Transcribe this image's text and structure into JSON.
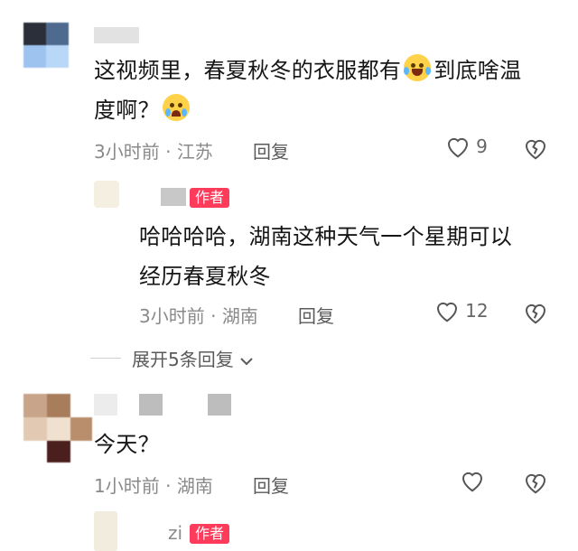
{
  "comments": [
    {
      "text_line1": "这视频里，春夏秋冬的衣服都有",
      "text_line1b": "到底啥温",
      "text_line2": "度啊？",
      "time": "3小时前",
      "location": "江苏",
      "reply_label": "回复",
      "likes": "9",
      "emoji1": "laughing-crying-emoji",
      "emoji2": "crying-emoji"
    },
    {
      "author_tag": "作者",
      "text_line1": "哈哈哈哈，湖南这种天气一个星期可以",
      "text_line2": "经历春夏秋冬",
      "time": "3小时前",
      "location": "湖南",
      "reply_label": "回复",
      "likes": "12"
    },
    {
      "text": "今天？",
      "time": "1小时前",
      "location": "湖南",
      "reply_label": "回复"
    },
    {
      "author_name": "zi",
      "author_tag": "作者"
    }
  ],
  "expand_replies": "展开5条回复",
  "separator": "·",
  "colors": {
    "tag": "#ff3b5c",
    "meta": "#8a8a8a"
  }
}
